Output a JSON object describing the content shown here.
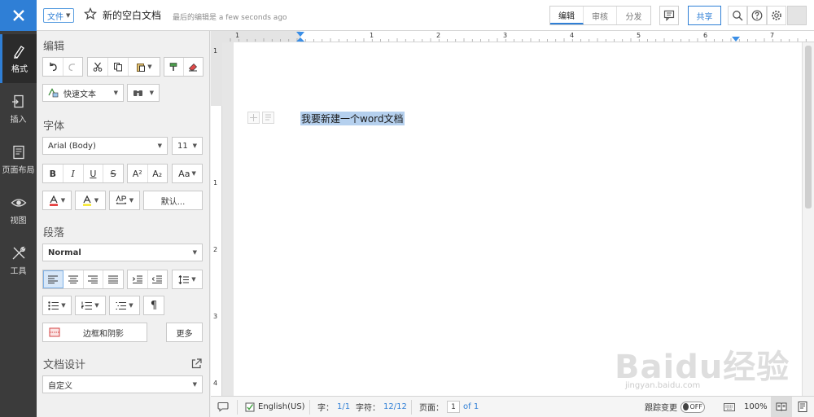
{
  "colors": {
    "accent": "#2f7fd6",
    "nav_bg": "#3b3b3b",
    "selection": "#b5d0ee"
  },
  "topbar": {
    "file_label": "文件",
    "doc_title": "新的空白文档",
    "save_status": "最后的编辑是 a few seconds ago",
    "mode_tabs": [
      "编辑",
      "审核",
      "分发"
    ],
    "share_label": "共享"
  },
  "leftnav": {
    "items": [
      {
        "label": "格式",
        "icon": "format-icon"
      },
      {
        "label": "插入",
        "icon": "insert-icon"
      },
      {
        "label": "页面布局",
        "icon": "page-layout-icon"
      },
      {
        "label": "视图",
        "icon": "view-eye-icon"
      },
      {
        "label": "工具",
        "icon": "tools-icon"
      }
    ]
  },
  "panel": {
    "edit_title": "编辑",
    "quick_text_label": "快速文本",
    "font_title": "字体",
    "font_family": "Arial (Body)",
    "font_size": "11",
    "default_label": "默认...",
    "paragraph_title": "段落",
    "style_value": "Normal",
    "borders_label": "边框和阴影",
    "more_label": "更多",
    "doc_design_title": "文档设计",
    "doc_design_value": "自定义"
  },
  "ruler": {
    "h_marks": [
      "1",
      "1",
      "2",
      "3",
      "4",
      "5",
      "6",
      "7"
    ],
    "v_marks": [
      "1",
      "1",
      "2",
      "3",
      "4"
    ]
  },
  "document": {
    "text": "我要新建一个word文档"
  },
  "statusbar": {
    "language": "English(US)",
    "words_label": "字：",
    "words_value": "1/1",
    "chars_label": "字符：",
    "chars_value": "12/12",
    "page_label": "页面：",
    "page_value": "1",
    "page_of": "of 1",
    "track_label": "跟踪变更",
    "track_state": "OFF",
    "zoom": "100%"
  },
  "watermark": {
    "brand": "Baidu经验",
    "url": "jingyan.baidu.com"
  }
}
